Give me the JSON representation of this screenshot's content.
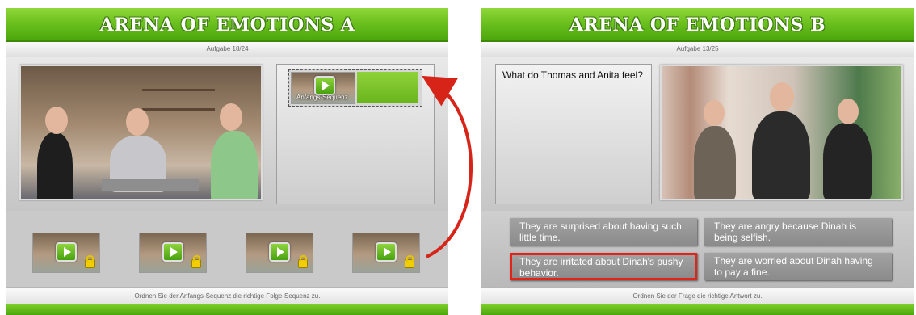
{
  "panel_a": {
    "title": "ARENA OF EMOTIONS A",
    "task": "Aufgabe 18/24",
    "selected_thumb_label": "Anfangs-Sequenz",
    "footer": "Ordnen Sie der Anfangs-Sequenz die richtige Folge-Sequenz zu.",
    "thumbnail_count": 4
  },
  "panel_b": {
    "title": "ARENA OF EMOTIONS B",
    "task": "Aufgabe 13/25",
    "question": "What do Thomas and Anita feel?",
    "answers": [
      "They are surprised about having such little time.",
      "They are angry because Dinah is being selfish.",
      "They are irritated about Dinah's pushy behavior.",
      "They are worried about Dinah having to pay a fine."
    ],
    "selected_answer_index": 2,
    "footer": "Ordnen Sie der Frage die richtige Antwort zu."
  },
  "colors": {
    "accent_green": "#6cc11e",
    "selection_red": "#e0241a",
    "arrow_red": "#d62418"
  }
}
